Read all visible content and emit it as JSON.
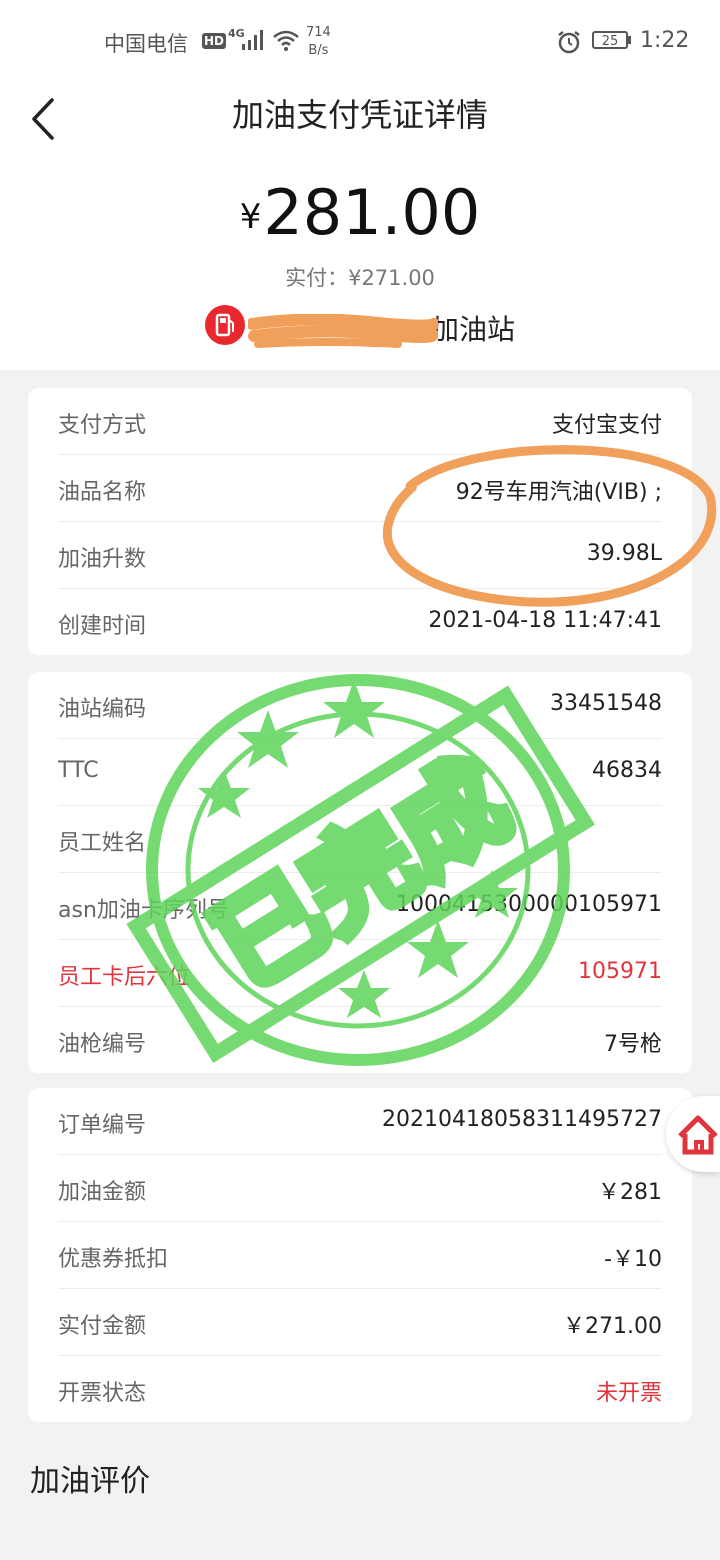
{
  "status_bar": {
    "carrier": "中国电信",
    "hd": "HD",
    "network": "4G",
    "speed_value": "714",
    "speed_unit": "B/s",
    "battery": "25",
    "time": "1:22"
  },
  "header": {
    "title": "加油支付凭证详情"
  },
  "summary": {
    "currency": "¥",
    "amount": "281.00",
    "paid": "实付：¥271.00",
    "station_name": "加油站"
  },
  "payment_card": {
    "rows": [
      {
        "label": "支付方式",
        "value": "支付宝支付"
      },
      {
        "label": "油品名称",
        "value": "92号车用汽油(VIB) ;"
      },
      {
        "label": "加油升数",
        "value": "39.98L"
      },
      {
        "label": "创建时间",
        "value": "2021-04-18 11:47:41"
      }
    ]
  },
  "station_card": {
    "rows": [
      {
        "label": "油站编码",
        "value": "33451548"
      },
      {
        "label": "TTC",
        "value": "46834"
      },
      {
        "label": "员工姓名",
        "value": ""
      },
      {
        "label": "asn加油卡序列号",
        "value": "1000415300000105971"
      },
      {
        "label": "员工卡后六位",
        "value": "105971"
      },
      {
        "label": "油枪编号",
        "value": "7号枪"
      }
    ]
  },
  "order_card": {
    "rows": [
      {
        "label": "订单编号",
        "value": "20210418058311495727"
      },
      {
        "label": "加油金额",
        "value": "￥281"
      },
      {
        "label": "优惠券抵扣",
        "value": "-￥10"
      },
      {
        "label": "实付金额",
        "value": "￥271.00"
      },
      {
        "label": "开票状态",
        "value": "未开票"
      }
    ]
  },
  "stamp": {
    "text": "已完成"
  },
  "rating": {
    "title": "加油评价"
  },
  "colors": {
    "accent_red": "#e0353d",
    "stamp_green": "#5fd45a",
    "annotation_orange": "#f0a05a"
  },
  "icons": [
    "back-arrow-icon",
    "fuel-pump-icon",
    "home-icon",
    "signal-icon",
    "wifi-icon",
    "alarm-icon",
    "battery-icon"
  ]
}
